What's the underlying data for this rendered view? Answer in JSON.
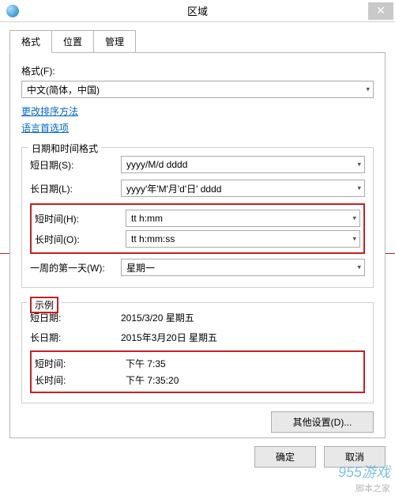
{
  "window": {
    "title": "区域",
    "close_icon": "✕"
  },
  "tabs": {
    "format": "格式",
    "location": "位置",
    "management": "管理"
  },
  "format": {
    "label": "格式(F):",
    "value": "中文(简体，中国)"
  },
  "links": {
    "change_sort": "更改排序方法",
    "language_prefs": "语言首选项"
  },
  "datetime": {
    "legend": "日期和时间格式",
    "short_date": {
      "label": "短日期(S):",
      "value": "yyyy/M/d dddd"
    },
    "long_date": {
      "label": "长日期(L):",
      "value": "yyyy'年'M'月'd'日' dddd"
    },
    "short_time": {
      "label": "短时间(H):",
      "value": "tt h:mm"
    },
    "long_time": {
      "label": "长时间(O):",
      "value": "tt h:mm:ss"
    },
    "first_day": {
      "label": "一周的第一天(W):",
      "value": "星期一"
    }
  },
  "example": {
    "legend": "示例",
    "short_date": {
      "label": "短日期:",
      "value": "2015/3/20 星期五"
    },
    "long_date": {
      "label": "长日期:",
      "value": "2015年3月20日 星期五"
    },
    "short_time": {
      "label": "短时间:",
      "value": "下午 7:35"
    },
    "long_time": {
      "label": "长时间:",
      "value": "下午 7:35:20"
    }
  },
  "buttons": {
    "other_settings": "其他设置(D)...",
    "ok": "确定",
    "cancel": "取消"
  },
  "watermark": "955游戏",
  "watermark2": "脚本之家"
}
